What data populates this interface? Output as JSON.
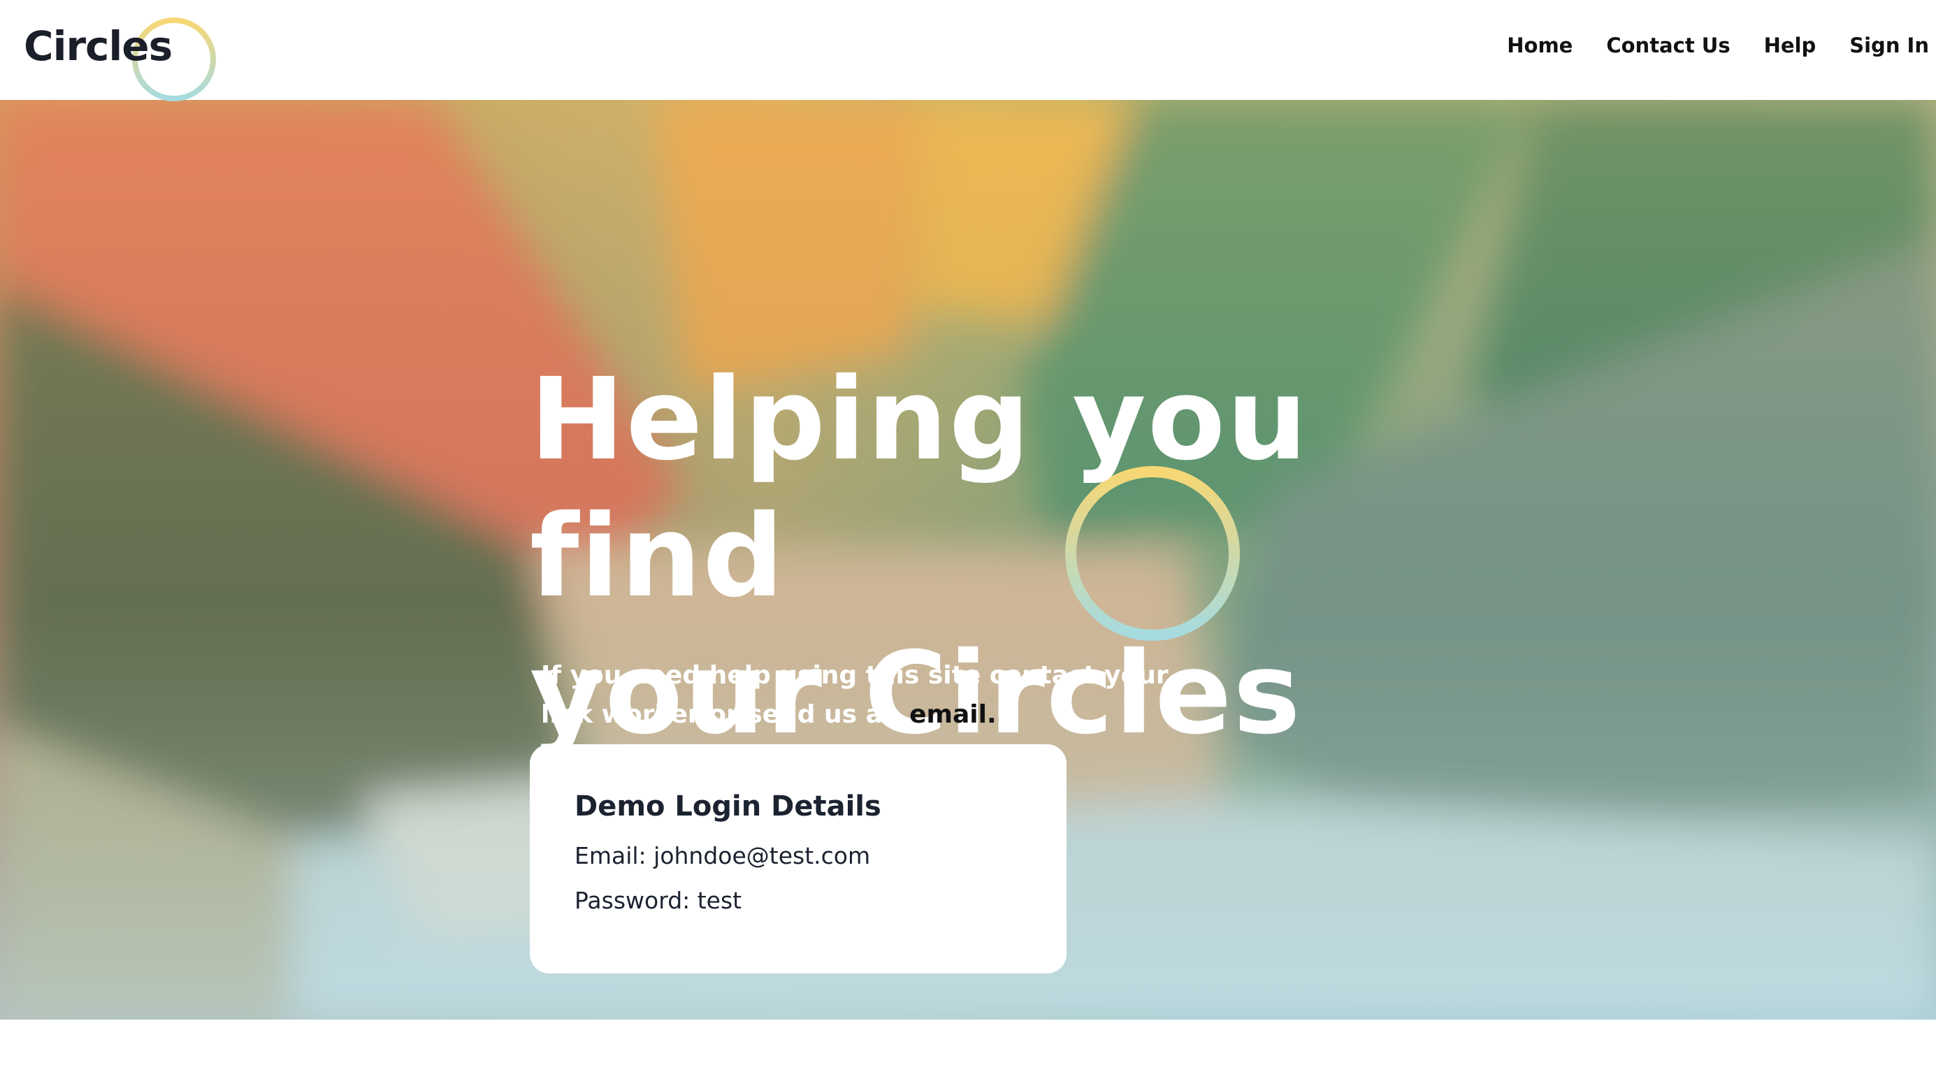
{
  "brand": {
    "name": "Circles",
    "ring_colors": [
      "#f7d774",
      "#a6dbe0"
    ]
  },
  "nav": {
    "items": [
      {
        "label": "Home"
      },
      {
        "label": "Contact Us"
      },
      {
        "label": "Help"
      },
      {
        "label": "Sign In"
      }
    ]
  },
  "hero": {
    "title_line1": "Helping you find",
    "title_line2": "your Circles",
    "subtitle_prefix": "If you need help using this site contact your link worker or send us an",
    "subtitle_link": "email."
  },
  "demo": {
    "title": "Demo Login Details",
    "email_line": "Email: johndoe@test.com",
    "password_line": "Password: test"
  },
  "colors": {
    "text_dark": "#1b2230",
    "white": "#ffffff"
  }
}
